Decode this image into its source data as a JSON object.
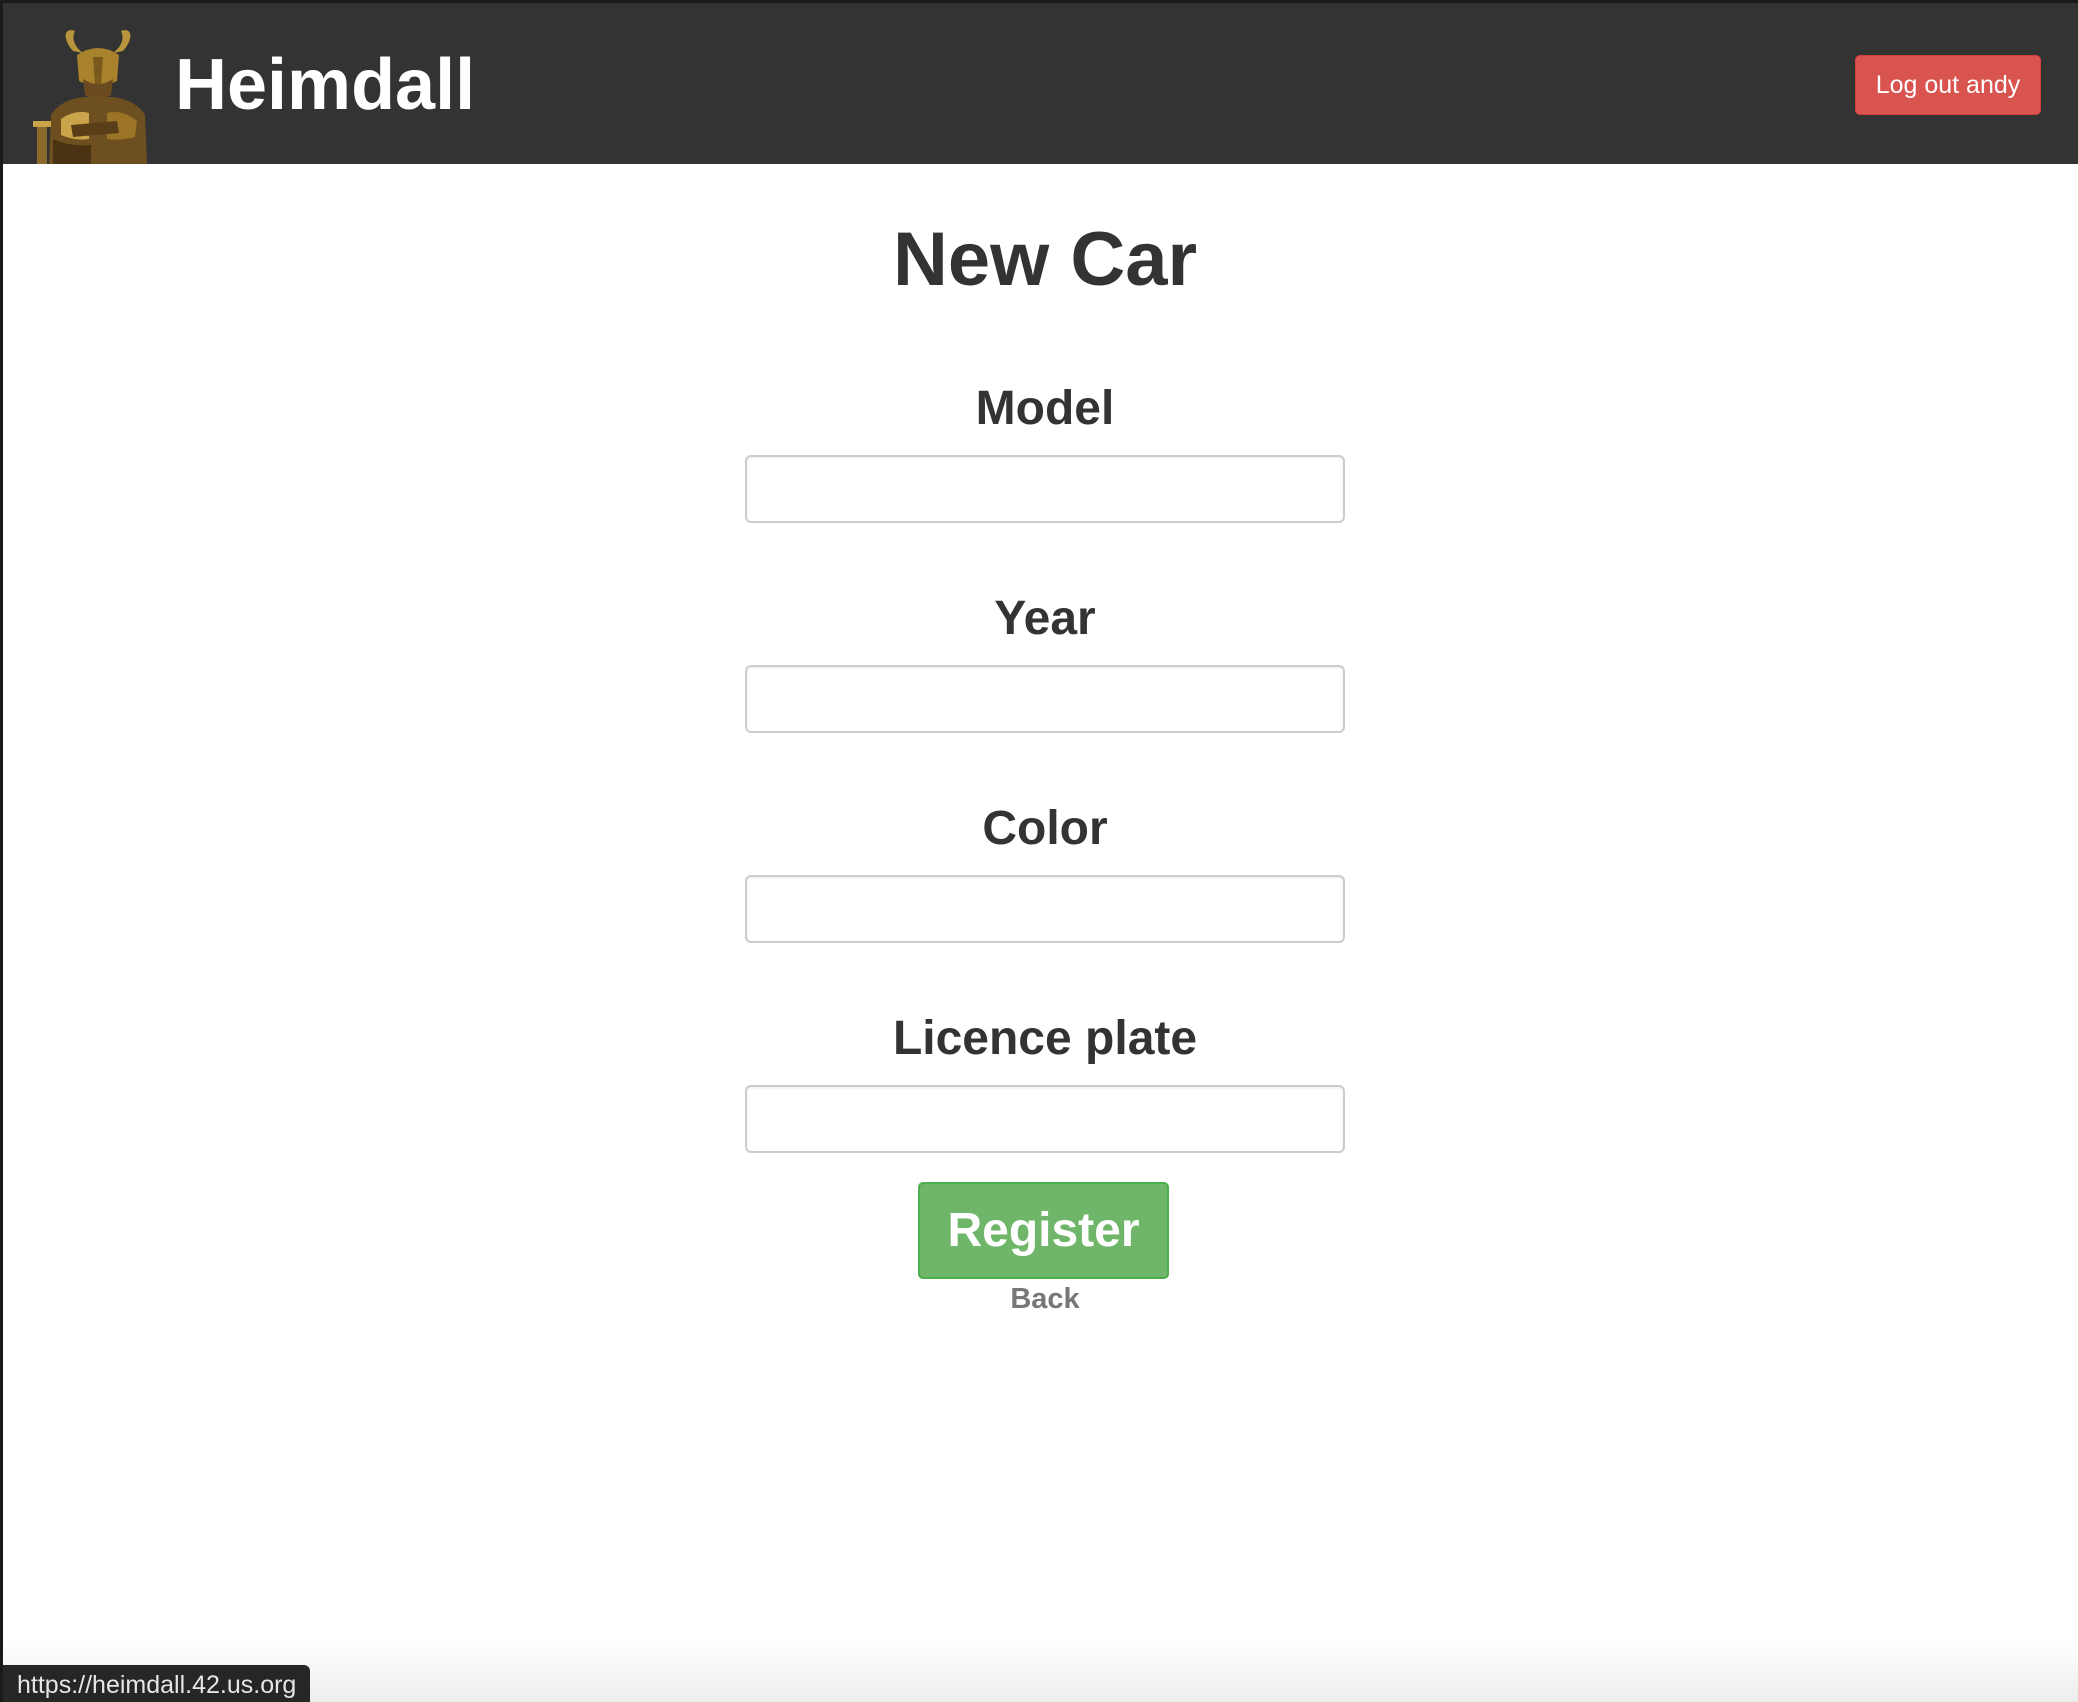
{
  "navbar": {
    "brand": "Heimdall",
    "logout_label": "Log out andy"
  },
  "page": {
    "title": "New Car"
  },
  "form": {
    "fields": [
      {
        "label": "Model",
        "value": ""
      },
      {
        "label": "Year",
        "value": ""
      },
      {
        "label": "Color",
        "value": ""
      },
      {
        "label": "Licence plate",
        "value": ""
      }
    ],
    "submit_label": "Register",
    "back_label": "Back"
  },
  "status_bar": {
    "url": "https://heimdall.42.us.org"
  },
  "colors": {
    "navbar": "#333333",
    "logout": "#d9534f",
    "register": "#6fb66a"
  },
  "icons": {
    "logo": "heimdall-warrior-logo"
  }
}
